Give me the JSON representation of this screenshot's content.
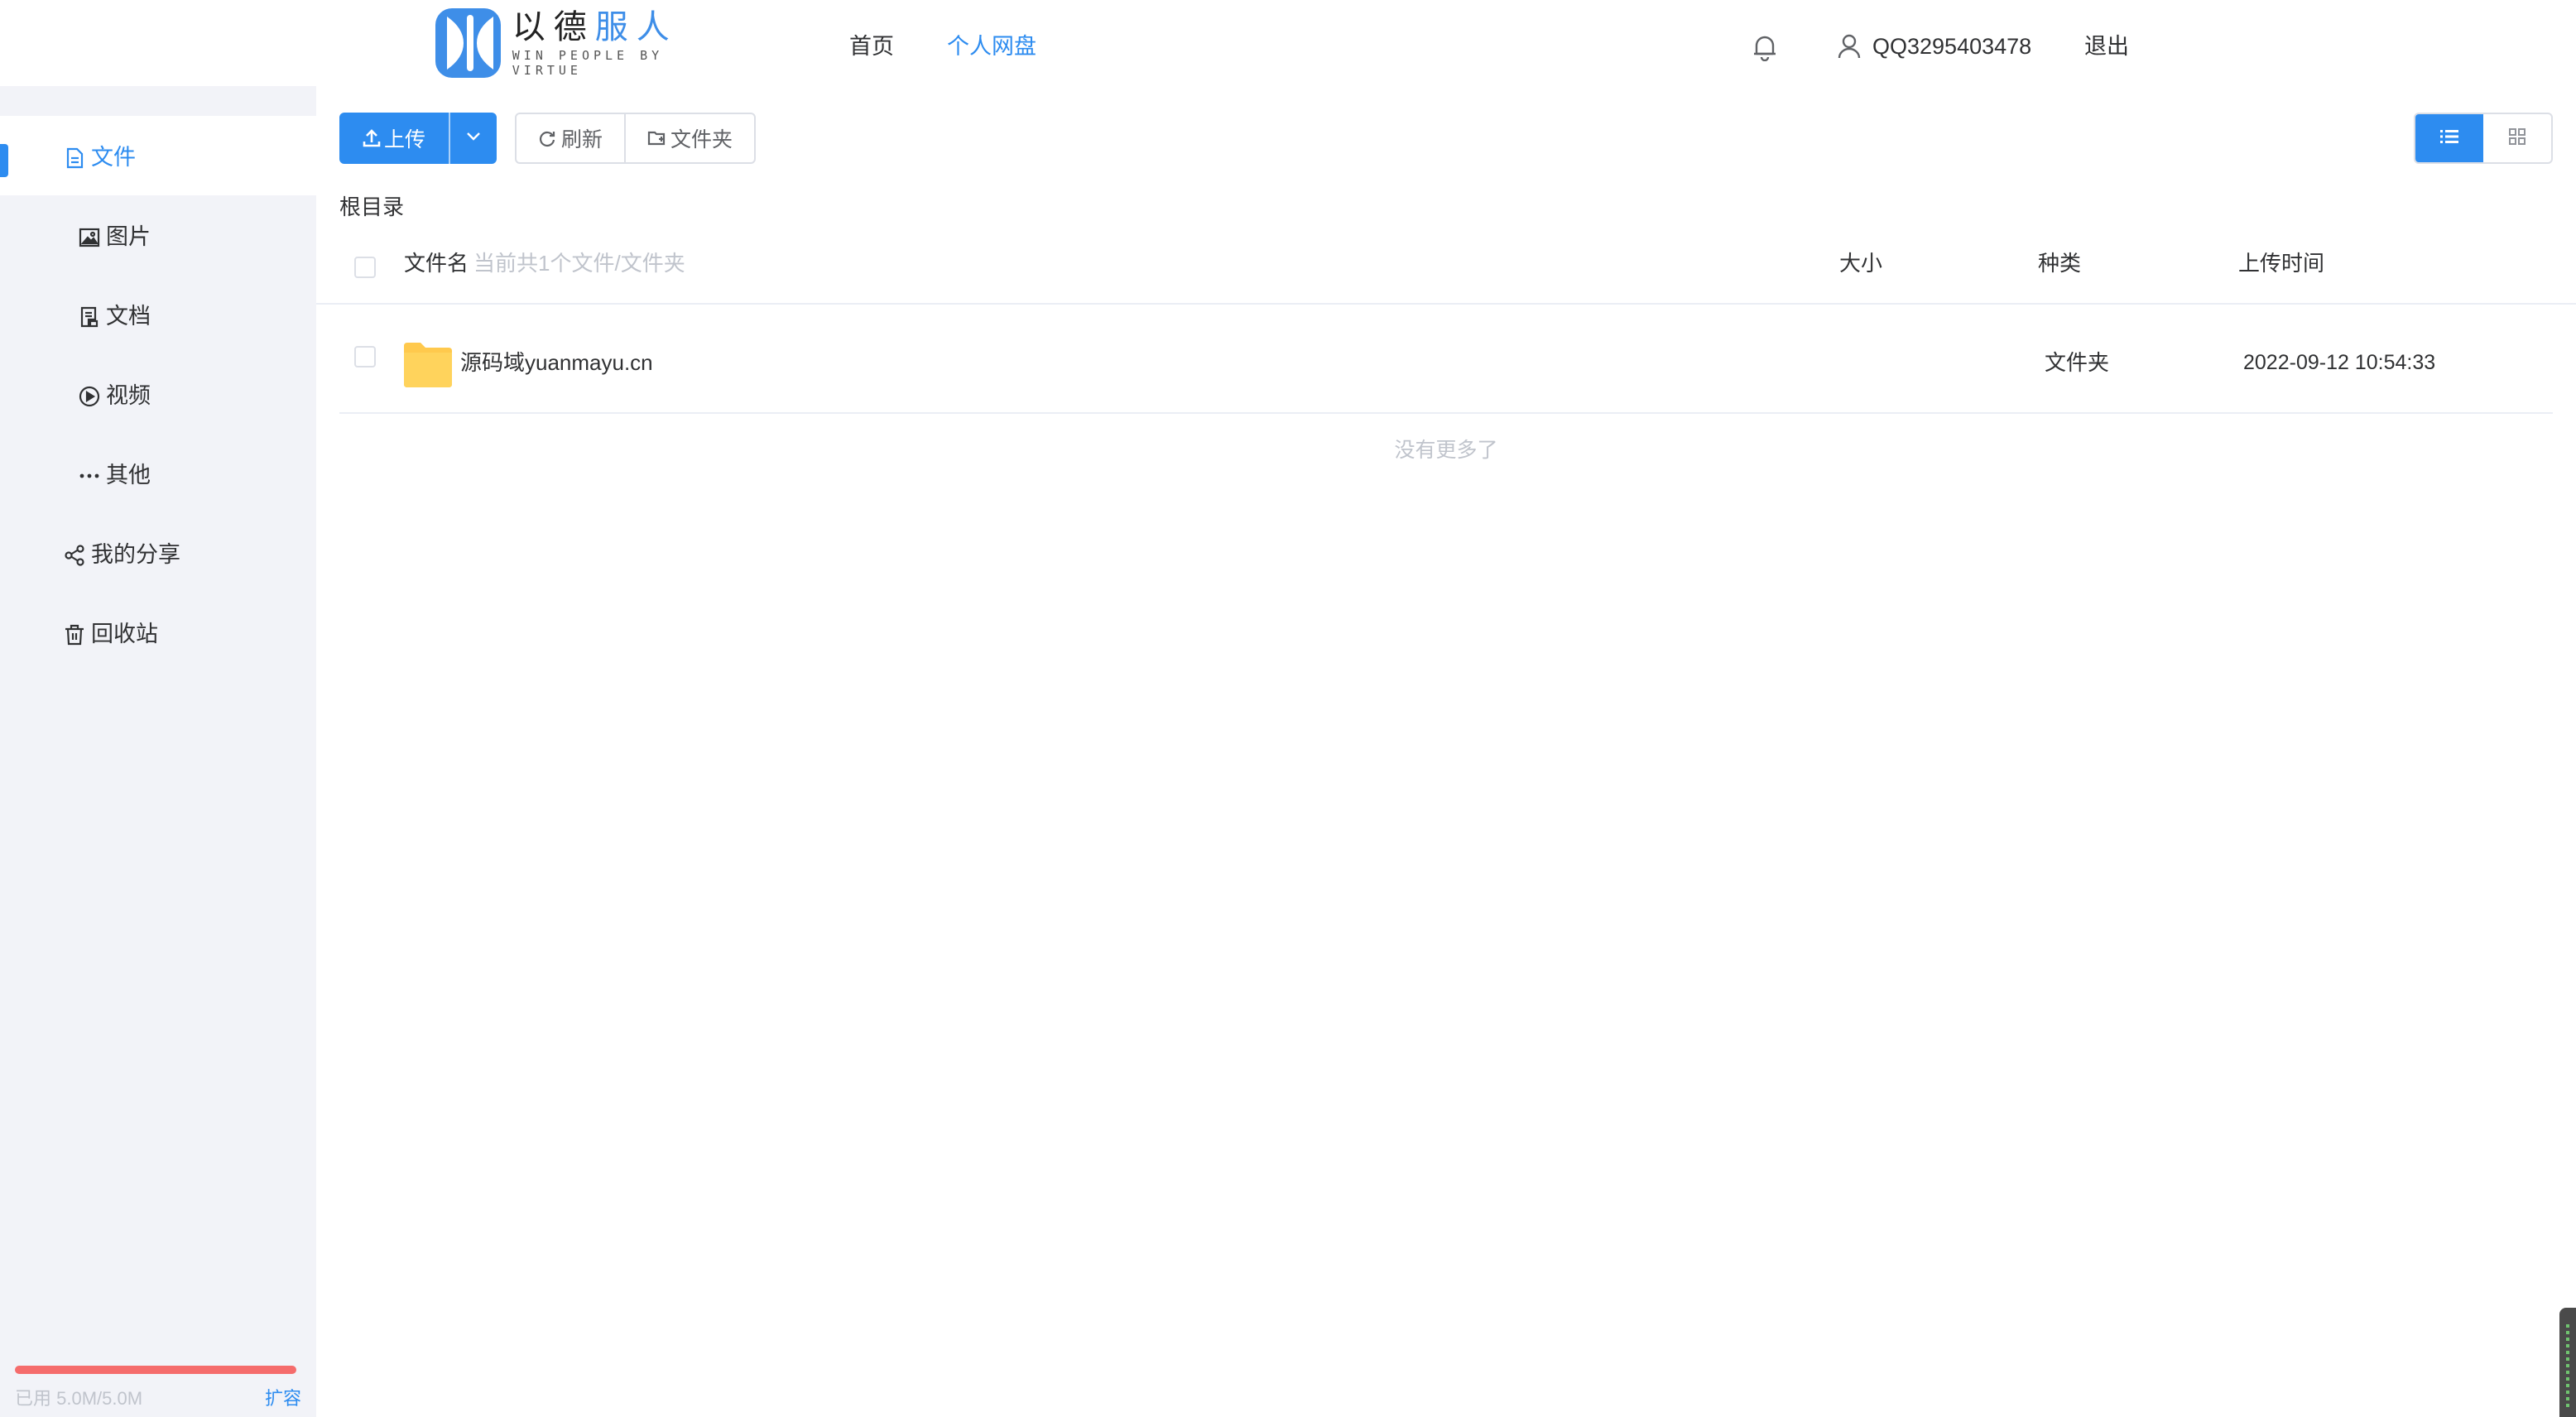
{
  "header": {
    "logo_cn_a": "以德",
    "logo_cn_b": "服人",
    "logo_en": "WIN PEOPLE BY VIRTUE",
    "nav": [
      {
        "label": "首页",
        "active": false
      },
      {
        "label": "个人网盘",
        "active": true
      }
    ],
    "user": "QQ3295403478",
    "logout": "退出"
  },
  "sidebar": {
    "items": [
      {
        "label": "文件",
        "icon": "file-icon",
        "active": true
      },
      {
        "label": "图片",
        "icon": "image-icon"
      },
      {
        "label": "文档",
        "icon": "document-icon"
      },
      {
        "label": "视频",
        "icon": "video-icon"
      },
      {
        "label": "其他",
        "icon": "more-icon"
      },
      {
        "label": "我的分享",
        "icon": "share-icon"
      },
      {
        "label": "回收站",
        "icon": "trash-icon"
      }
    ],
    "storage": {
      "used_text": "已用 5.0M/5.0M",
      "used_fraction": 1.0,
      "expand": "扩容"
    }
  },
  "toolbar": {
    "upload": "上传",
    "refresh": "刷新",
    "new_folder": "文件夹",
    "view_mode": "list"
  },
  "breadcrumb": "根目录",
  "table": {
    "columns": {
      "name": "文件名",
      "name_sub": "当前共1个文件/文件夹",
      "size": "大小",
      "type": "种类",
      "time": "上传时间"
    },
    "rows": [
      {
        "name": "源码域yuanmayu.cn",
        "size": "",
        "type": "文件夹",
        "time": "2022-09-12 10:54:33"
      }
    ],
    "footer": "没有更多了"
  },
  "colors": {
    "accent": "#2d8cf0",
    "sidebar_bg": "#f2f3f8",
    "storage_bar": "#f56c6c",
    "folder": "#ffc94d"
  }
}
